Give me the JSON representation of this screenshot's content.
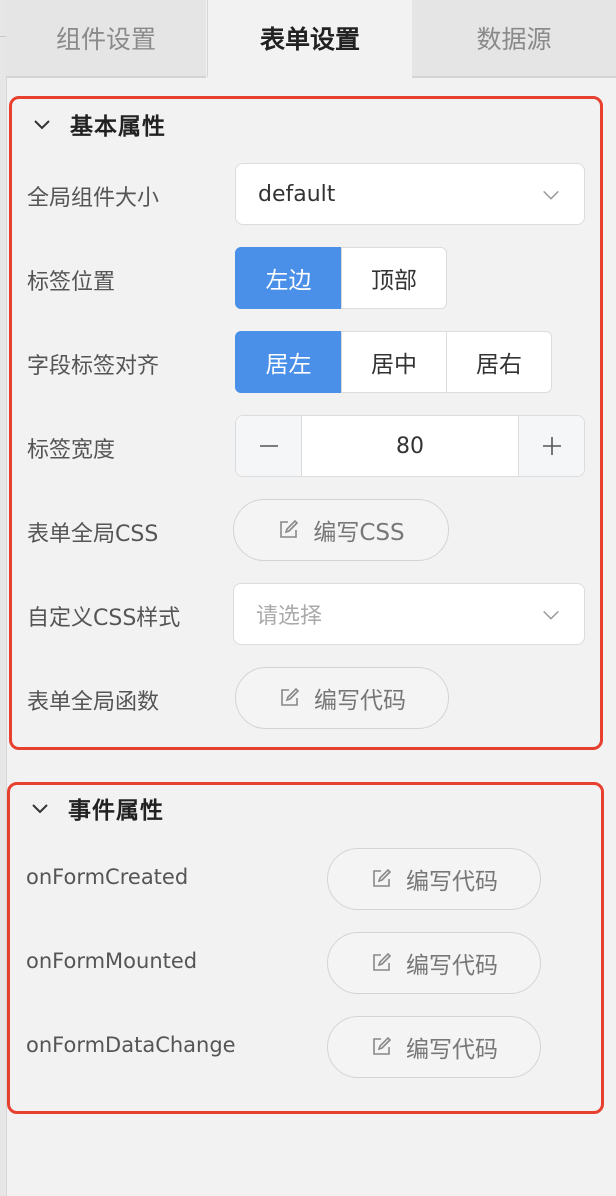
{
  "tabs": [
    "组件设置",
    "表单设置",
    "数据源"
  ],
  "active_tab": "表单设置",
  "basic": {
    "title": "基本属性",
    "size_label": "全局组件大小",
    "size_value": "default",
    "label_pos_label": "标签位置",
    "label_pos_options": [
      "左边",
      "顶部"
    ],
    "label_pos_selected": "左边",
    "align_label": "字段标签对齐",
    "align_options": [
      "居左",
      "居中",
      "居右"
    ],
    "align_selected": "居左",
    "width_label": "标签宽度",
    "width_value": "80",
    "css_label": "表单全局CSS",
    "css_button": "编写CSS",
    "custom_css_label": "自定义CSS样式",
    "custom_css_placeholder": "请选择",
    "func_label": "表单全局函数",
    "func_button": "编写代码"
  },
  "events": {
    "title": "事件属性",
    "items": [
      {
        "name": "onFormCreated",
        "button": "编写代码"
      },
      {
        "name": "onFormMounted",
        "button": "编写代码"
      },
      {
        "name": "onFormDataChange",
        "button": "编写代码"
      }
    ]
  },
  "colors": {
    "accent": "#4a8fe8",
    "highlight_border": "#e8402f"
  },
  "icons": {
    "collapse": "chevron-down-icon",
    "select_arrow": "chevron-down-icon",
    "edit": "edit-icon",
    "minus": "minus-icon",
    "plus": "plus-icon"
  }
}
